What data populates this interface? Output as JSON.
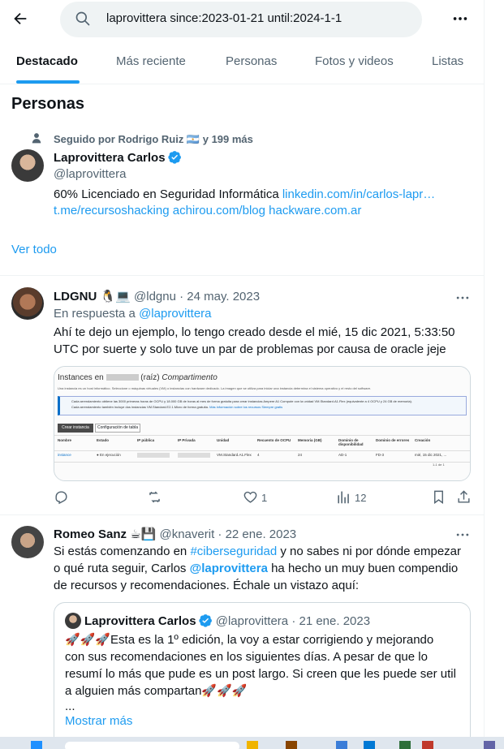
{
  "header": {
    "search_value": "laprovittera since:2023-01-21 until:2024-1-1",
    "icons": [
      "back-arrow-icon",
      "search-icon",
      "more-icon"
    ]
  },
  "tabs": [
    {
      "label": "Destacado",
      "active": true
    },
    {
      "label": "Más reciente",
      "active": false
    },
    {
      "label": "Personas",
      "active": false
    },
    {
      "label": "Fotos y videos",
      "active": false
    },
    {
      "label": "Listas",
      "active": false
    }
  ],
  "people": {
    "section_title": "Personas",
    "followed_by": "Seguido por Rodrigo Ruiz 🇦🇷 y 199 más",
    "name": "Laprovittera Carlos",
    "handle": "@laprovittera",
    "bio_text": "60% Licenciado en Seguridad Informática ",
    "bio_link1": "linkedin.com/in/carlos-lapr…",
    "bio_link2": "t.me/recursoshacking",
    "bio_link3": "achirou.com/blog",
    "bio_link4": "hackware.com.ar",
    "ver_todo": "Ver todo"
  },
  "tweet1": {
    "name": "LDGNU",
    "emojis": "🐧💻",
    "handle": "@ldgnu",
    "date": "· 24 may. 2023",
    "reply_prefix": "En respuesta a ",
    "reply_to": "@laprovittera",
    "text_line1": "Ahí te dejo un ejemplo, lo tengo creado desde el mié, 15 dic 2021, 5:33:50",
    "text_line2": "UTC por suerte y solo tuve un par de problemas por causa de oracle jeje",
    "likes": "1",
    "views": "12",
    "screenshot": {
      "title_prefix": "Instances en",
      "title_mid": "(raíz)",
      "title_suffix": "Compartimento",
      "intro": "Una instancia es un host informático. Seleccione o máquinas virtuales (VM) o instancias con hardware dedicado. La imagen que se utiliza para iniciar una instancia determina el sistema operativo y el resto del software.",
      "info_line1": "Cada arrendamiento obtiene las 3000 primeras horas de OCPU y 18.000 GB de horas al mes de forma gratuita para crear instancias Ampere A1 Compute con la unidad VM.Standard.A1.Flex (equivalente a 4 OCPU y 24 GB de memoria).",
      "info_line2": "Cada arrendamiento también incluye dos instancias VM.Standard.E2.1.Micro de forma gratuita.",
      "info_link": "Más información sobre los recursos Siempre gratis",
      "btn_create": "Crear instancia",
      "btn_table": "Configuración de tabla",
      "columns": [
        "Nombre",
        "Estado",
        "IP pública",
        "IP Privada",
        "Unidad",
        "Recuento de OCPU",
        "Memoria (GB)",
        "Dominio de disponibilidad",
        "Dominio de errores",
        "Creación"
      ],
      "row": [
        "instance",
        "En ejecución",
        "",
        "",
        "VM.Standard.A1.Flex",
        "4",
        "24",
        "AD-1",
        "FD-3",
        "mié, 15 dic 2021, ..."
      ],
      "pager": "1-1 de 1"
    }
  },
  "tweet2": {
    "name": "Romeo Sanz",
    "emojis": "☕💾",
    "handle": "@knaverit",
    "date": "· 22 ene. 2023",
    "line1_a": "Si estás comenzando en ",
    "line1_tag": "#ciberseguridad",
    "line1_b": " y no sabes ni por dónde empezar",
    "line2_a": "o qué ruta seguir, Carlos ",
    "line2_mention": "@laprovittera",
    "line2_b": " ha hecho un muy buen compendio",
    "line3": "de recursos y recomendaciones. Échale un vistazo aquí:"
  },
  "quote": {
    "name": "Laprovittera Carlos",
    "handle": "@laprovittera",
    "date": "· 21 ene. 2023",
    "line1": "🚀🚀🚀Esta es la 1º edición, la voy a estar corrigiendo y mejorando",
    "line2": "con sus recomendaciones en los siguientes días. A pesar de que lo",
    "line3": "resumí lo más que pude es un post largo. Si creen que les puede ser util",
    "line4": "a alguien más compartan🚀🚀🚀",
    "line5": "...",
    "show_more": "Mostrar más"
  }
}
